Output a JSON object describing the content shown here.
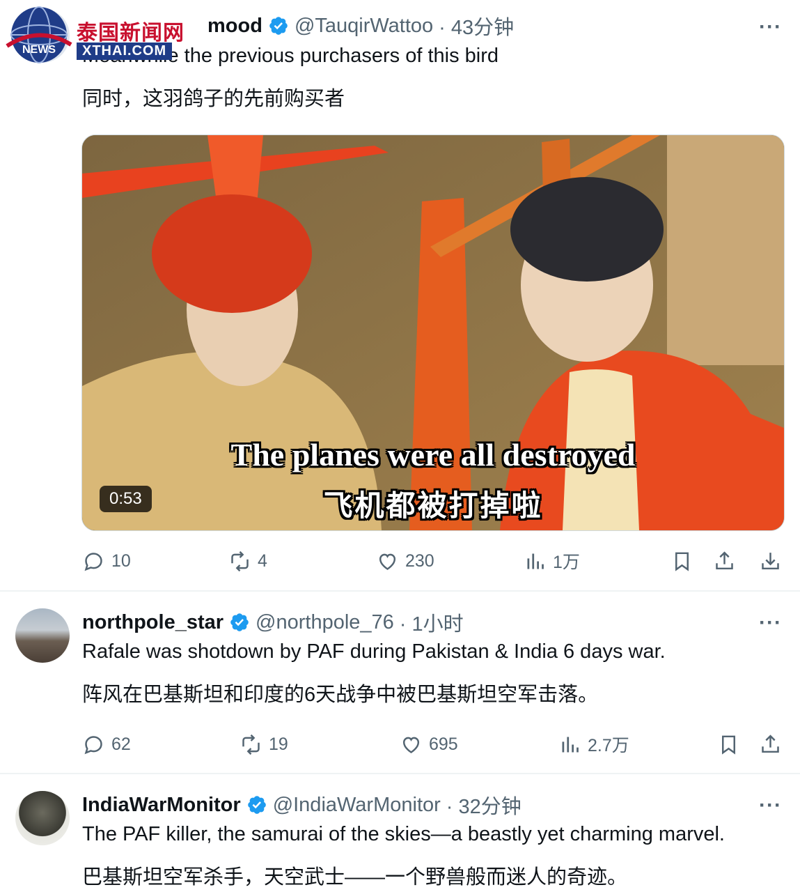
{
  "watermark": {
    "cn": "泰国新闻网",
    "site": "XTHAI.COM",
    "logo_text": "NEWS"
  },
  "tweets": [
    {
      "name": "Hassan Mahmood",
      "name_visible": "mood",
      "handle": "@TauqirWattoo",
      "time": "· 43分钟",
      "text_en": "Meanwhile the previous purchasers of this bird",
      "text_zh": "同时，这羽鸽子的先前购买者",
      "media": {
        "subtitle_en": "The planes were all destroyed",
        "subtitle_zh": "飞机都被打掉啦",
        "duration": "0:53"
      },
      "actions": {
        "replies": "10",
        "reposts": "4",
        "likes": "230",
        "views": "1万"
      }
    },
    {
      "name": "northpole_star",
      "handle": "@northpole_76",
      "time": "· 1小时",
      "text_en": "Rafale was shotdown by PAF during Pakistan & India 6 days war.",
      "text_zh": "阵风在巴基斯坦和印度的6天战争中被巴基斯坦空军击落。",
      "actions": {
        "replies": "62",
        "reposts": "19",
        "likes": "695",
        "views": "2.7万"
      }
    },
    {
      "name": "IndiaWarMonitor",
      "handle": "@IndiaWarMonitor",
      "time": "· 32分钟",
      "text_en": "The PAF killer, the samurai of the skies—a beastly yet charming marvel.",
      "text_zh": "巴基斯坦空军杀手，天空武士——一个野兽般而迷人的奇迹。"
    }
  ],
  "more_label": "···",
  "colors": {
    "verified": "#1d9bf0",
    "muted": "#536471",
    "divider": "#eff3f4"
  }
}
